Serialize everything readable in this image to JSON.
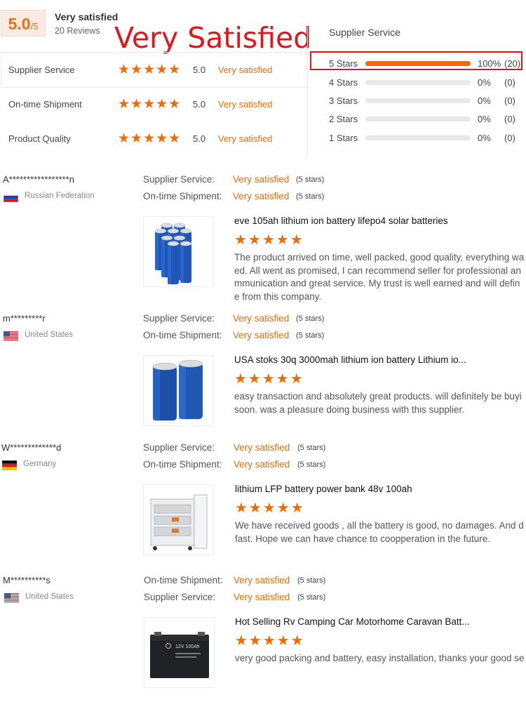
{
  "summary": {
    "score": "5.0",
    "score_max": "/5",
    "title": "Very satisfied",
    "reviews": "20 Reviews",
    "overlay_text": "Very Satisfied"
  },
  "ratings": [
    {
      "label": "Supplier Service",
      "stars": "★★★★★",
      "value": "5.0",
      "text": "Very satisfied"
    },
    {
      "label": "On-time Shipment",
      "stars": "★★★★★",
      "value": "5.0",
      "text": "Very satisfied"
    },
    {
      "label": "Product Quality",
      "stars": "★★★★★",
      "value": "5.0",
      "text": "Very satisfied"
    }
  ],
  "distribution": {
    "title": "Supplier Service",
    "rows": [
      {
        "label": "5 Stars",
        "fraction": 1.0,
        "pct": "100%",
        "count": "(20)"
      },
      {
        "label": "4 Stars",
        "fraction": 0,
        "pct": "0%",
        "count": "(0)"
      },
      {
        "label": "3 Stars",
        "fraction": 0,
        "pct": "0%",
        "count": "(0)"
      },
      {
        "label": "2 Stars",
        "fraction": 0,
        "pct": "0%",
        "count": "(0)"
      },
      {
        "label": "1 Stars",
        "fraction": 0,
        "pct": "0%",
        "count": "(0)"
      }
    ]
  },
  "reviews": [
    {
      "name": "A*****************n",
      "country": "Russian Federation",
      "flag": "ru",
      "line1_label": "Supplier Service:",
      "line1_value": "Very satisfied",
      "line1_note": "(5 stars)",
      "line2_label": "On-time Shipment:",
      "line2_value": "Very satisfied",
      "line2_note": "(5 stars)",
      "title": "eve 105ah lithium ion battery lifepo4 solar batteries",
      "stars": "★★★★★",
      "body": "The product arrived on time, well packed, good quality, everything wa\ned. All went as promised, I can recommend seller for professional an\nmmunication and great service. My trust is well earned and will defin\ne from this company.",
      "image": "blue-cylinder-cells"
    },
    {
      "name": "m*********r",
      "country": "United States",
      "flag": "us",
      "line1_label": "Supplier Service:",
      "line1_value": "Very satisfied",
      "line1_note": "(5 stars)",
      "line2_label": "On-time Shipment:",
      "line2_value": "Very satisfied",
      "line2_note": "(5 stars)",
      "title": "USA stoks 30q 3000mah lithium ion battery Lithium io...",
      "stars": "★★★★★",
      "body": "easy transaction and absolutely great products. will definitely be buyi\nsoon. was a pleasure doing business with this supplier.",
      "image": "two-blue-cells"
    },
    {
      "name": "W*************d",
      "country": "Germany",
      "flag": "de",
      "line1_label": "Supplier Service:",
      "line1_value": "Very satisfied",
      "line1_note": "(5 stars)",
      "line2_label": "On-time Shipment:",
      "line2_value": "Very satisfied",
      "line2_note": "(5 stars)",
      "title": "lithium LFP battery power bank 48v 100ah",
      "stars": "★★★★★",
      "body": "We have received goods , all the battery is good, no damages. And d\nfast. Hope we can have chance to coopperation in the future.",
      "image": "battery-cabinet"
    },
    {
      "name": "M**********s",
      "country": "United States",
      "flag": "us",
      "line1_label": "On-time Shipment:",
      "line1_value": "Very satisfied",
      "line1_note": "(5 stars)",
      "line2_label": "Supplier Service:",
      "line2_value": "Very satisfied",
      "line2_note": "(5 stars)",
      "title": "Hot Selling Rv Camping Car Motorhome Caravan Batt...",
      "stars": "★★★★★",
      "body": "very good packing and battery, easy installation, thanks your good se",
      "image": "black-battery",
      "image_text": "12V 100Ah"
    }
  ],
  "colors": {
    "accent": "#f56a00",
    "highlight_box": "#d9191c",
    "overlay": "#e3151a"
  }
}
